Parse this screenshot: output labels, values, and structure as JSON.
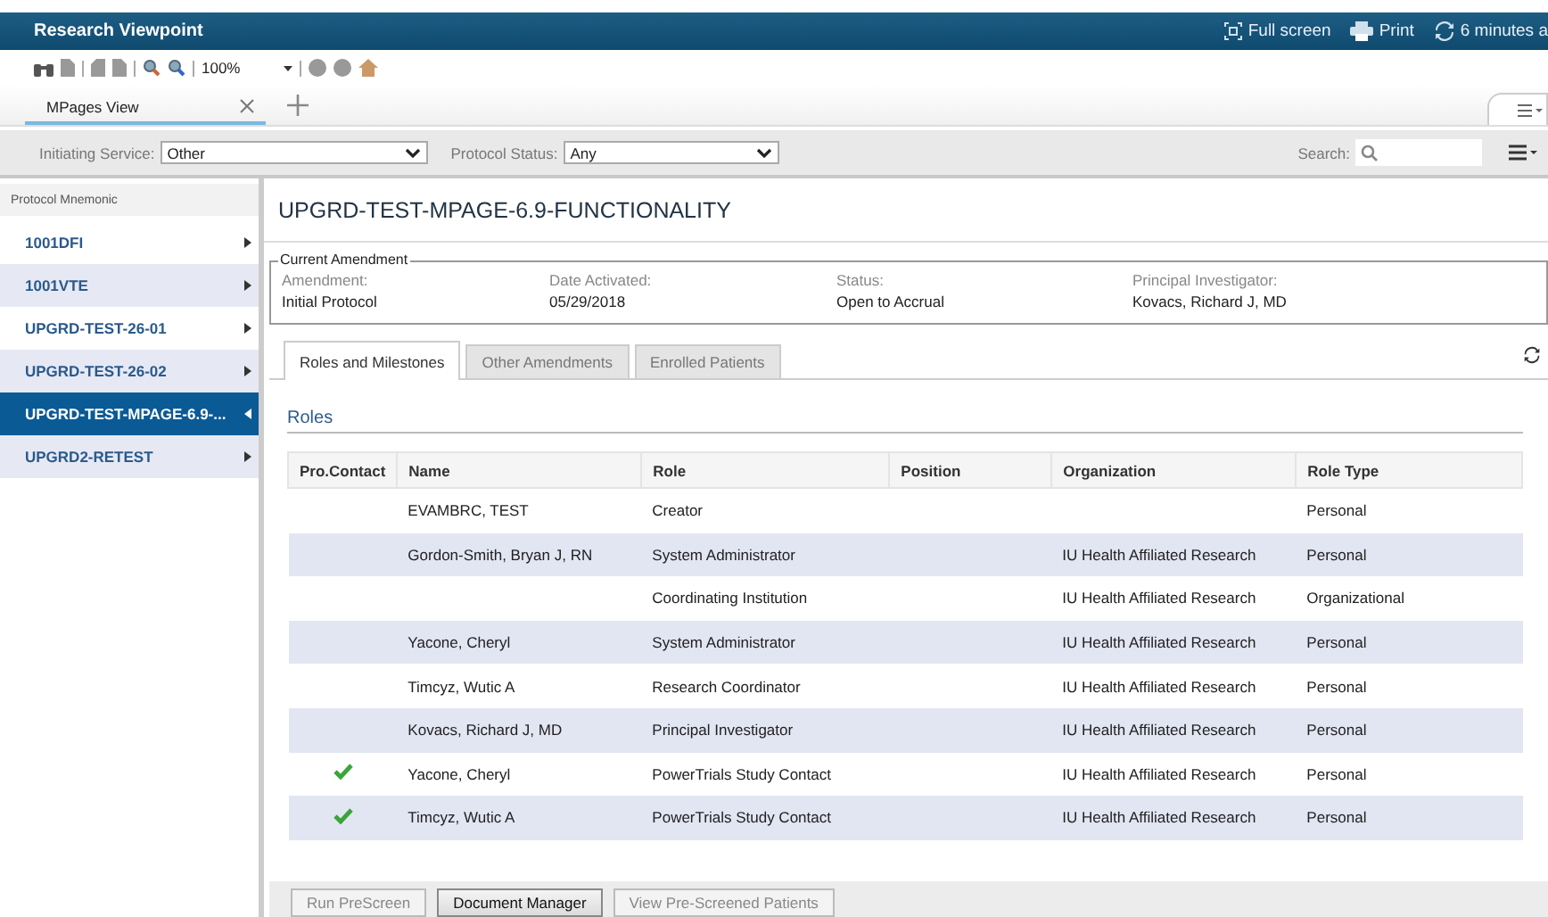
{
  "window": {
    "title": "Research Viewpoint",
    "actions": [
      {
        "kind": "fullscreen",
        "label": "Full screen"
      },
      {
        "kind": "print",
        "label": "Print"
      },
      {
        "kind": "refresh",
        "label": "6 minutes a"
      }
    ]
  },
  "toolbar": {
    "zoom": "100%"
  },
  "tabs": [
    {
      "label": "MPages View",
      "selected": true
    }
  ],
  "filters": {
    "initiating_service": {
      "label": "Initiating Service:",
      "value": "Other"
    },
    "protocol_status": {
      "label": "Protocol Status:",
      "value": "Any"
    },
    "search": {
      "label": "Search:"
    }
  },
  "sidebar": {
    "heading": "Protocol Mnemonic",
    "items": [
      {
        "label": "1001DFI",
        "selected": false
      },
      {
        "label": "1001VTE",
        "selected": false
      },
      {
        "label": "UPGRD-TEST-26-01",
        "selected": false
      },
      {
        "label": "UPGRD-TEST-26-02",
        "selected": false
      },
      {
        "label": "UPGRD-TEST-MPAGE-6.9-...",
        "selected": true
      },
      {
        "label": "UPGRD2-RETEST",
        "selected": false
      }
    ]
  },
  "protocol": {
    "title": "UPGRD-TEST-MPAGE-6.9-FUNCTIONALITY",
    "amendment": {
      "legend": "Current Amendment",
      "fields": [
        {
          "label": "Amendment:",
          "value": "Initial Protocol"
        },
        {
          "label": "Date Activated:",
          "value": "05/29/2018"
        },
        {
          "label": "Status:",
          "value": "Open to Accrual"
        },
        {
          "label": "Principal Investigator:",
          "value": "Kovacs, Richard J, MD"
        }
      ]
    },
    "tabs": [
      {
        "label": "Roles and Milestones",
        "selected": true
      },
      {
        "label": "Other Amendments",
        "selected": false
      },
      {
        "label": "Enrolled Patients",
        "selected": false
      }
    ],
    "section": "Roles",
    "table": {
      "columns": [
        "Pro.Contact",
        "Name",
        "Role",
        "Position",
        "Organization",
        "Role Type"
      ],
      "rows": [
        {
          "pro_contact": false,
          "name": "EVAMBRC, TEST",
          "role": "Creator",
          "organization": "",
          "role_type": "Personal"
        },
        {
          "pro_contact": false,
          "name": "Gordon-Smith, Bryan J, RN",
          "role": "System Administrator",
          "organization": "IU Health Affiliated Research",
          "role_type": "Personal"
        },
        {
          "pro_contact": false,
          "name": "",
          "role": "Coordinating Institution",
          "organization": "IU Health Affiliated Research",
          "role_type": "Organizational"
        },
        {
          "pro_contact": false,
          "name": "Yacone, Cheryl",
          "role": "System Administrator",
          "organization": "IU Health Affiliated Research",
          "role_type": "Personal"
        },
        {
          "pro_contact": false,
          "name": "Timcyz, Wutic A",
          "role": "Research Coordinator",
          "organization": "IU Health Affiliated Research",
          "role_type": "Personal"
        },
        {
          "pro_contact": false,
          "name": "Kovacs, Richard J, MD",
          "role": "Principal Investigator",
          "organization": "IU Health Affiliated Research",
          "role_type": "Personal"
        },
        {
          "pro_contact": true,
          "name": "Yacone, Cheryl",
          "role": "PowerTrials Study Contact",
          "organization": "IU Health Affiliated Research",
          "role_type": "Personal"
        },
        {
          "pro_contact": true,
          "name": "Timcyz, Wutic A",
          "role": "PowerTrials Study Contact",
          "organization": "IU Health Affiliated Research",
          "role_type": "Personal"
        }
      ]
    },
    "buttons": [
      {
        "label": "Run PreScreen",
        "disabled": true
      },
      {
        "label": "Document Manager",
        "disabled": false
      },
      {
        "label": "View Pre-Screened Patients",
        "disabled": true
      }
    ]
  }
}
